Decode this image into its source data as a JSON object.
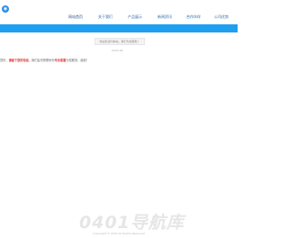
{
  "nav": [
    {
      "label": "网站首页"
    },
    {
      "label": "关于我们"
    },
    {
      "label": "产品展示"
    },
    {
      "label": "新闻资讯"
    },
    {
      "label": "合作伙伴"
    },
    {
      "label": "公司优势"
    }
  ],
  "notice": "欢迎您访问本站，我们为您服务！",
  "date": "2023-06",
  "message": {
    "prefix": "您好，",
    "highlight1": "请留下您的电话",
    "middle": "，我们会尽快联系你",
    "highlight2": "专业客服",
    "suffix": "为您服务，谢谢！"
  },
  "watermark": "0401导航库",
  "footer": "Copyright © 2023 All Rights Reserved",
  "colors": {
    "accent": "#1e9ff0",
    "highlight": "#e03030"
  }
}
